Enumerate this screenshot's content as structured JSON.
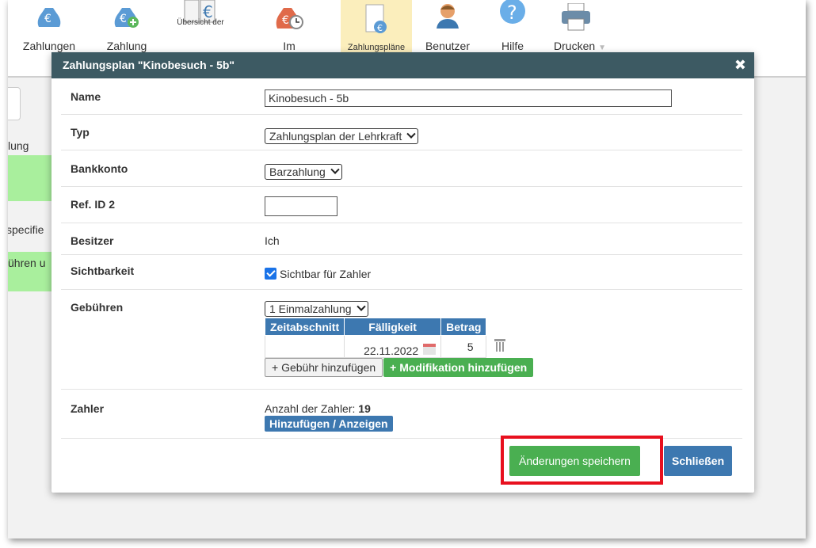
{
  "toolbar": {
    "items": [
      {
        "label": "Zahlungen",
        "icon": "euro-coin-icon"
      },
      {
        "label": "Zahlung",
        "icon": "euro-add-icon"
      },
      {
        "label": "Übersicht der",
        "icon": "euro-book-icon"
      },
      {
        "label": "Im",
        "icon": "euro-clock-icon"
      },
      {
        "label": "Zahlungspläne",
        "icon": "payment-plan-icon",
        "active": true
      },
      {
        "label": "Benutzer",
        "icon": "user-icon"
      },
      {
        "label": "Hilfe",
        "icon": "help-icon"
      },
      {
        "label": "Drucken",
        "icon": "printer-icon",
        "arrow": "▼"
      }
    ]
  },
  "background": {
    "text_1": "lung",
    "text_2": "specifie",
    "text_3": "ühren u"
  },
  "modal": {
    "title": "Zahlungsplan \"Kinobesuch - 5b\"",
    "close": "✖",
    "name_label": "Name",
    "name_value": "Kinobesuch - 5b",
    "type_label": "Typ",
    "type_value": "Zahlungsplan der Lehrkraft",
    "bank_label": "Bankkonto",
    "bank_value": "Barzahlung",
    "ref_label": "Ref. ID 2",
    "ref_value": "",
    "owner_label": "Besitzer",
    "owner_value": "Ich",
    "visibility_label": "Sichtbarkeit",
    "visibility_value": "Sichtbar für Zahler",
    "visibility_checked": true,
    "fees_label": "Gebühren",
    "fees_select": "1 Einmalzahlung",
    "fees_table": {
      "headers": [
        "Zeitabschnitt",
        "Fälligkeit",
        "Betrag"
      ],
      "rows": [
        {
          "period": "",
          "due": "22.11.2022",
          "amount": "5"
        }
      ]
    },
    "add_fee_label": "+ Gebühr hinzufügen",
    "add_modification_label": "+ Modifikation hinzufügen",
    "payers_label": "Zahler",
    "payers_count_label": "Anzahl der Zahler: ",
    "payers_count": "19",
    "payers_button": "Hinzufügen / Anzeigen",
    "save_label": "Änderungen speichern",
    "close_label": "Schließen"
  },
  "colors": {
    "header": "#3d5a63",
    "blue": "#3d78b0",
    "green": "#4aaf51",
    "highlight": "#e8101e"
  }
}
